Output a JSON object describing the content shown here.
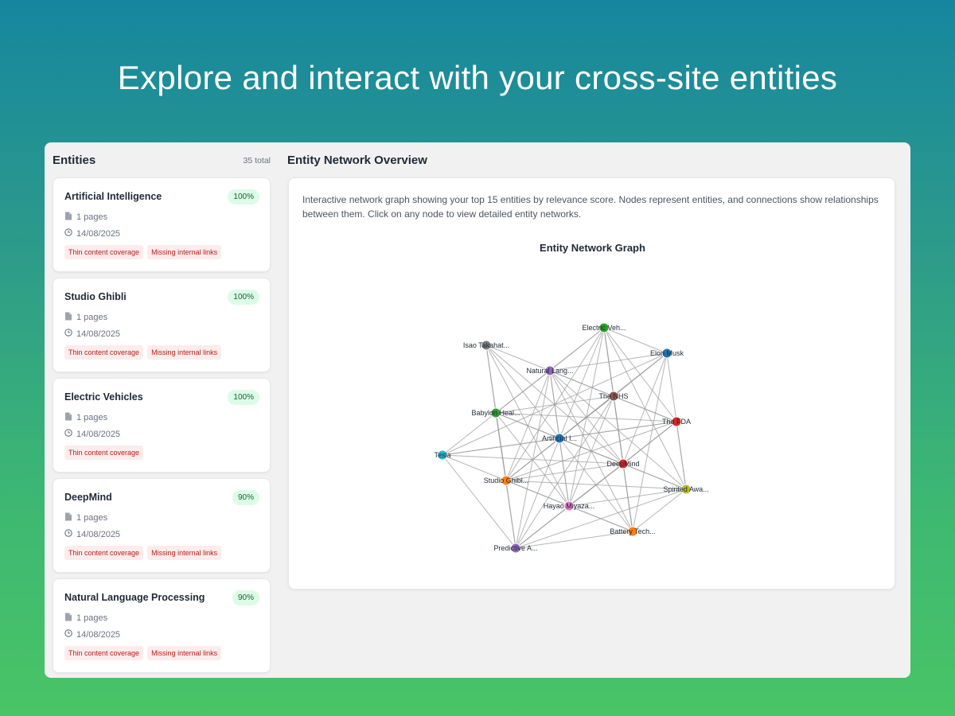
{
  "hero": {
    "title": "Explore and interact with your cross-site entities"
  },
  "entities_panel": {
    "title": "Entities",
    "total": "35 total",
    "cards": [
      {
        "name": "Artificial Intelligence",
        "score": "100%",
        "pages": "1 pages",
        "date": "14/08/2025",
        "tags": [
          "Thin content coverage",
          "Missing internal links"
        ]
      },
      {
        "name": "Studio Ghibli",
        "score": "100%",
        "pages": "1 pages",
        "date": "14/08/2025",
        "tags": [
          "Thin content coverage",
          "Missing internal links"
        ]
      },
      {
        "name": "Electric Vehicles",
        "score": "100%",
        "pages": "1 pages",
        "date": "14/08/2025",
        "tags": [
          "Thin content coverage"
        ]
      },
      {
        "name": "DeepMind",
        "score": "90%",
        "pages": "1 pages",
        "date": "14/08/2025",
        "tags": [
          "Thin content coverage",
          "Missing internal links"
        ]
      },
      {
        "name": "Natural Language Processing",
        "score": "90%",
        "pages": "1 pages",
        "date": "14/08/2025",
        "tags": [
          "Thin content coverage",
          "Missing internal links"
        ]
      }
    ]
  },
  "network": {
    "heading": "Entity Network Overview",
    "description": "Interactive network graph showing your top 15 entities by relevance score. Nodes represent entities, and connections show relationships between them. Click on any node to view detailed entity networks.",
    "graph_title": "Entity Network Graph",
    "nodes": [
      {
        "id": "ev",
        "label": "Electric Veh...",
        "color": "#2ca02c"
      },
      {
        "id": "isao",
        "label": "Isao Takahat...",
        "color": "#7f7f7f"
      },
      {
        "id": "musk",
        "label": "Elon Musk",
        "color": "#1f77b4"
      },
      {
        "id": "nlp",
        "label": "Natural Lang...",
        "color": "#9467bd"
      },
      {
        "id": "nhs",
        "label": "The NHS",
        "color": "#8c564b"
      },
      {
        "id": "babylon",
        "label": "Babylon Heal...",
        "color": "#2ca02c"
      },
      {
        "id": "fda",
        "label": "The FDA",
        "color": "#d62728"
      },
      {
        "id": "ai",
        "label": "Artificial I...",
        "color": "#1f77b4"
      },
      {
        "id": "tesla",
        "label": "Tesla",
        "color": "#17becf"
      },
      {
        "id": "deepmind",
        "label": "DeepMind",
        "color": "#d62728"
      },
      {
        "id": "ghibli",
        "label": "Studio Ghibl...",
        "color": "#ff7f0e"
      },
      {
        "id": "spirited",
        "label": "Spirited Awa...",
        "color": "#bcbd22"
      },
      {
        "id": "miyazaki",
        "label": "Hayao Miyaza...",
        "color": "#e377c2"
      },
      {
        "id": "battery",
        "label": "Battery Tech...",
        "color": "#ff7f0e"
      },
      {
        "id": "predictive",
        "label": "Predictive A...",
        "color": "#9467bd"
      }
    ],
    "edges": [
      [
        "ev",
        "musk"
      ],
      [
        "ev",
        "nlp"
      ],
      [
        "ev",
        "babylon"
      ],
      [
        "ev",
        "nhs"
      ],
      [
        "ev",
        "fda"
      ],
      [
        "ev",
        "ai"
      ],
      [
        "ev",
        "deepmind"
      ],
      [
        "ev",
        "battery"
      ],
      [
        "ev",
        "spirited"
      ],
      [
        "ev",
        "miyazaki"
      ],
      [
        "ev",
        "ghibli"
      ],
      [
        "isao",
        "nlp"
      ],
      [
        "isao",
        "babylon"
      ],
      [
        "isao",
        "ai"
      ],
      [
        "isao",
        "miyazaki"
      ],
      [
        "isao",
        "ghibli"
      ],
      [
        "isao",
        "deepmind"
      ],
      [
        "musk",
        "nlp"
      ],
      [
        "musk",
        "ai"
      ],
      [
        "musk",
        "deepmind"
      ],
      [
        "musk",
        "spirited"
      ],
      [
        "musk",
        "tesla"
      ],
      [
        "musk",
        "battery"
      ],
      [
        "musk",
        "nhs"
      ],
      [
        "musk",
        "ghibli"
      ],
      [
        "nlp",
        "nhs"
      ],
      [
        "nlp",
        "fda"
      ],
      [
        "nlp",
        "ai"
      ],
      [
        "nlp",
        "babylon"
      ],
      [
        "nlp",
        "deepmind"
      ],
      [
        "nlp",
        "miyazaki"
      ],
      [
        "nlp",
        "ghibli"
      ],
      [
        "nlp",
        "predictive"
      ],
      [
        "nlp",
        "battery"
      ],
      [
        "nlp",
        "spirited"
      ],
      [
        "nhs",
        "babylon"
      ],
      [
        "nhs",
        "fda"
      ],
      [
        "nhs",
        "ai"
      ],
      [
        "nhs",
        "deepmind"
      ],
      [
        "nhs",
        "ghibli"
      ],
      [
        "nhs",
        "predictive"
      ],
      [
        "nhs",
        "battery"
      ],
      [
        "nhs",
        "miyazaki"
      ],
      [
        "babylon",
        "ai"
      ],
      [
        "babylon",
        "fda"
      ],
      [
        "babylon",
        "ghibli"
      ],
      [
        "babylon",
        "predictive"
      ],
      [
        "babylon",
        "deepmind"
      ],
      [
        "babylon",
        "miyazaki"
      ],
      [
        "babylon",
        "tesla"
      ],
      [
        "fda",
        "ai"
      ],
      [
        "fda",
        "deepmind"
      ],
      [
        "fda",
        "spirited"
      ],
      [
        "fda",
        "ghibli"
      ],
      [
        "fda",
        "miyazaki"
      ],
      [
        "fda",
        "predictive"
      ],
      [
        "fda",
        "tesla"
      ],
      [
        "ai",
        "tesla"
      ],
      [
        "ai",
        "deepmind"
      ],
      [
        "ai",
        "ghibli"
      ],
      [
        "ai",
        "miyazaki"
      ],
      [
        "ai",
        "battery"
      ],
      [
        "ai",
        "predictive"
      ],
      [
        "ai",
        "spirited"
      ],
      [
        "tesla",
        "ghibli"
      ],
      [
        "tesla",
        "predictive"
      ],
      [
        "tesla",
        "deepmind"
      ],
      [
        "deepmind",
        "ghibli"
      ],
      [
        "deepmind",
        "spirited"
      ],
      [
        "deepmind",
        "miyazaki"
      ],
      [
        "deepmind",
        "battery"
      ],
      [
        "deepmind",
        "predictive"
      ],
      [
        "ghibli",
        "miyazaki"
      ],
      [
        "ghibli",
        "predictive"
      ],
      [
        "ghibli",
        "spirited"
      ],
      [
        "ghibli",
        "battery"
      ],
      [
        "spirited",
        "miyazaki"
      ],
      [
        "spirited",
        "battery"
      ],
      [
        "spirited",
        "predictive"
      ],
      [
        "miyazaki",
        "battery"
      ],
      [
        "miyazaki",
        "predictive"
      ],
      [
        "battery",
        "predictive"
      ]
    ]
  }
}
